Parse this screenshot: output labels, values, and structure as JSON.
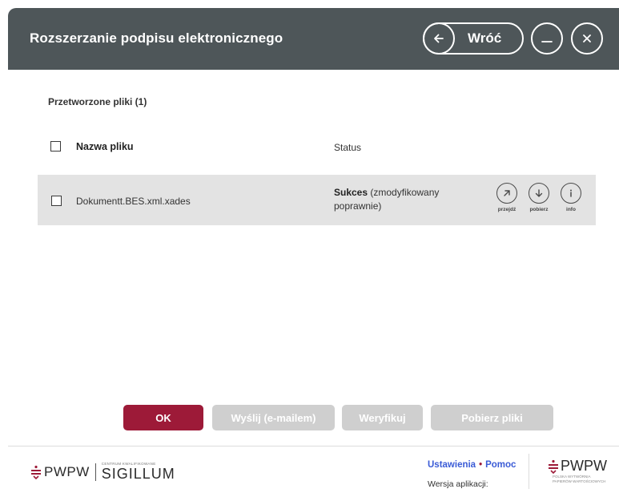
{
  "window": {
    "title": "Rozszerzanie podpisu elektronicznego",
    "back_label": "Wróć"
  },
  "files": {
    "section_label": "Przetworzone pliki (1)",
    "columns": {
      "name": "Nazwa pliku",
      "status": "Status"
    },
    "rows": [
      {
        "name": "Dokumentt.BES.xml.xades",
        "status_strong": "Sukces",
        "status_rest": " (zmodyfikowany poprawnie)",
        "actions": {
          "go": "przejdź",
          "download": "pobierz",
          "info": "info"
        }
      }
    ]
  },
  "buttons": {
    "ok": "OK",
    "email": "Wyślij (e-mailem)",
    "verify": "Weryfikuj",
    "download_files": "Pobierz pliki"
  },
  "footer": {
    "brand_left": "PWPW",
    "brand_small": "CENTRUM KWALIFIKOWANE",
    "brand_sigillum": "SIGILLUM",
    "settings": "Ustawienia",
    "help": "Pomoc",
    "version_label": "Wersja aplikacji:",
    "brand_right": "PWPW",
    "brand_right_sub1": "POLSKA WYTWÓRNIA",
    "brand_right_sub2": "PAPIERÓW WARTOŚCIOWYCH"
  },
  "colors": {
    "titlebar": "#4e5659",
    "primary": "#9d1a38",
    "disabled": "#cfcfcf",
    "link": "#3a5bd6",
    "row_bg": "#e3e3e3"
  }
}
